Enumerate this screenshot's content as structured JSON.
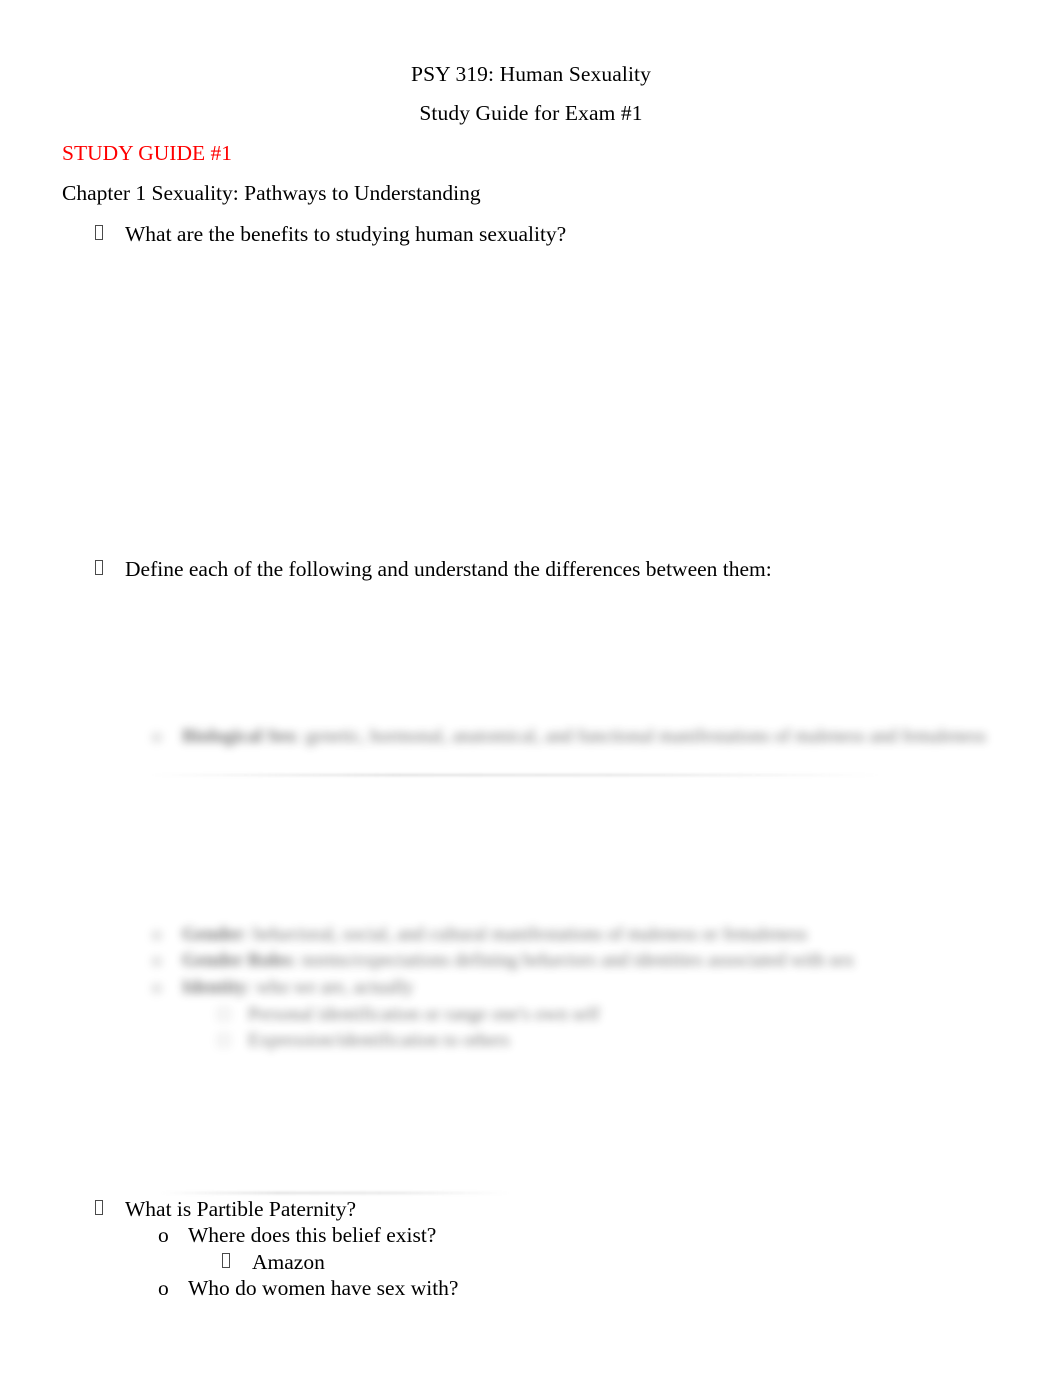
{
  "document": {
    "title_line_1": "PSY 319:   Human Sexuality",
    "title_line_2": "Study Guide for Exam #1",
    "section_heading": "STUDY GUIDE #1",
    "section_heading_color": "#FF0000",
    "chapter_heading": "Chapter 1 Sexuality: Pathways to Understanding",
    "background_color": "#FFFFFF",
    "text_color": "#000000"
  },
  "markers": {
    "level1_bullet": "tofu-box-glyph",
    "level2_bullet": "o",
    "level3_bullet": "tofu-box-glyph"
  },
  "outline": {
    "item_benefits": "What are the benefits to studying human sexuality?",
    "item_define": "Define each of the following and understand the differences between them:",
    "item_partible": "What is Partible Paternity?",
    "item_where": "Where does this belief exist?",
    "item_amazon": "Amazon",
    "item_who": "Who do women have sex with?"
  },
  "redacted": {
    "note": "blurred-illegible-text",
    "block_a": [
      {
        "bold": "Biological Sex",
        "rest": ": genetic, hormonal, anatomical, and functional manifestations of maleness and femaleness"
      }
    ],
    "block_b": [
      {
        "bold": "Gender",
        "rest": ": behavioral, social, and cultural manifestations of maleness or femaleness"
      },
      {
        "bold": "Gender Roles",
        "rest": ": norms/expectations defining behaviors and identities associated with sex"
      },
      {
        "bold": "Identity",
        "rest": ": who we are, actually"
      }
    ],
    "block_c": [
      {
        "bold": "",
        "rest": "Personal identification or range one's own self"
      },
      {
        "bold": "",
        "rest": "Expression/identification to others"
      }
    ]
  }
}
